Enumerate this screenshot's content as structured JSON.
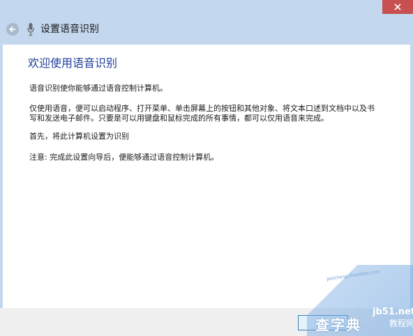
{
  "header": {
    "title": "设置语音识别"
  },
  "content": {
    "title": "欢迎使用语音识别",
    "paragraphs": [
      "语音识别使你能够通过语音控制计算机。",
      "仅使用语音，便可以启动程序、打开菜单、单击屏幕上的按钮和其他对象、将文本口述到文档中以及书",
      "写和发送电子邮件。只要是可以用键盘和鼠标完成的所有事情，都可以仅用语音来完成。",
      "首先，将此计算机设置为识别",
      "注意: 完成此设置向导后，便能够通过语音控制计算机。"
    ]
  },
  "watermark": {
    "url": "jiaocheng.chazidian.com",
    "brand": "jb51.net",
    "large": "查字典",
    "tutorial": "教程网"
  },
  "icons": {
    "close": "close-icon",
    "back": "back-arrow-icon",
    "mic": "microphone-icon"
  },
  "colors": {
    "frame": "#c3d7ee",
    "close_button": "#c75050",
    "heading": "#1e3e9a",
    "content_bg": "#ffffff"
  }
}
